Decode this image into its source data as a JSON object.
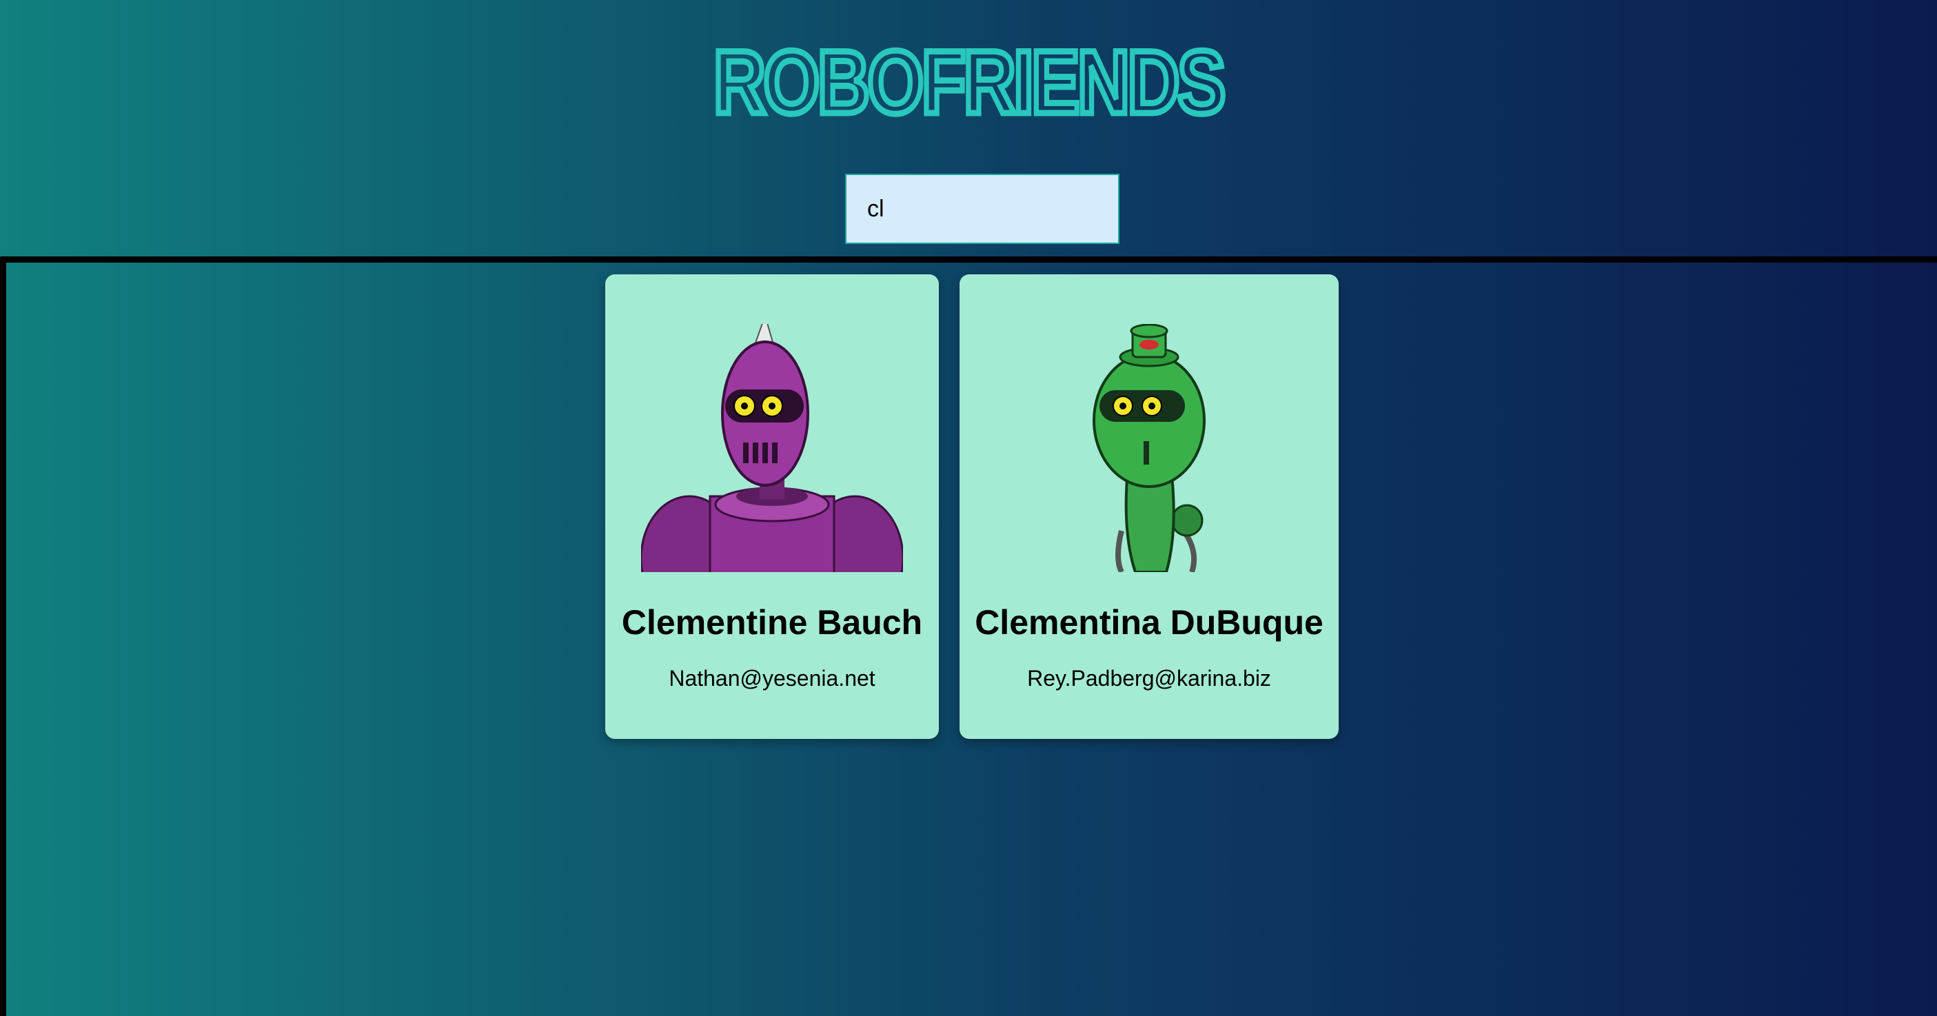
{
  "header": {
    "title": "ROBOFRIENDS"
  },
  "search": {
    "value": "cl"
  },
  "robots": [
    {
      "name": "Clementine Bauch",
      "email": "Nathan@yesenia.net",
      "avatar": "purple-robot"
    },
    {
      "name": "Clementina DuBuque",
      "email": "Rey.Padberg@karina.biz",
      "avatar": "green-robot"
    }
  ],
  "colors": {
    "title": "#28c8bd",
    "card_bg": "#a4ebd3",
    "search_bg": "#d4ecfc"
  }
}
